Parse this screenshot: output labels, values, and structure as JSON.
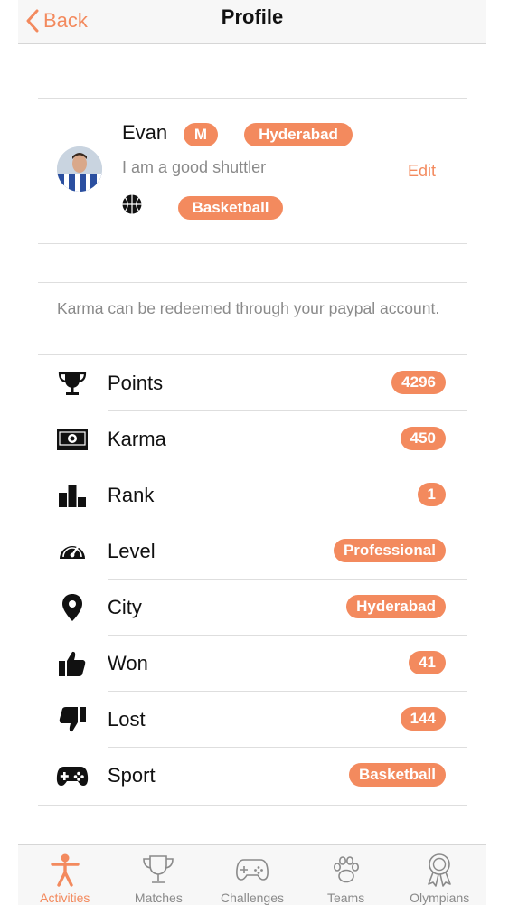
{
  "nav": {
    "back_label": "Back",
    "title": "Profile"
  },
  "profile": {
    "name": "Evan",
    "gender_badge": "M",
    "city_badge": "Hyderabad",
    "bio": "I am a good shuttler",
    "edit_label": "Edit",
    "sport_icon": "basketball-icon",
    "sport_badge": "Basketball"
  },
  "note": "Karma can be redeemed through your paypal account.",
  "stats": [
    {
      "label": "Points",
      "value": "4296",
      "icon": "trophy-icon"
    },
    {
      "label": "Karma",
      "value": "450",
      "icon": "money-icon"
    },
    {
      "label": "Rank",
      "value": "1",
      "icon": "rank-bars-icon"
    },
    {
      "label": "Level",
      "value": "Professional",
      "icon": "speedometer-icon"
    },
    {
      "label": "City",
      "value": "Hyderabad",
      "icon": "location-pin-icon"
    },
    {
      "label": "Won",
      "value": "41",
      "icon": "thumbs-up-icon"
    },
    {
      "label": "Lost",
      "value": "144",
      "icon": "thumbs-down-icon"
    },
    {
      "label": "Sport",
      "value": "Basketball",
      "icon": "gamepad-icon"
    }
  ],
  "tabs": [
    {
      "label": "Activities",
      "icon": "person-icon",
      "active": true
    },
    {
      "label": "Matches",
      "icon": "trophy-outline-icon",
      "active": false
    },
    {
      "label": "Challenges",
      "icon": "gamepad-outline-icon",
      "active": false
    },
    {
      "label": "Teams",
      "icon": "paw-icon",
      "active": false
    },
    {
      "label": "Olympians",
      "icon": "medal-icon",
      "active": false
    }
  ],
  "colors": {
    "accent": "#f38a5e",
    "muted_text": "#8a8a8a",
    "bar_bg": "#f7f7f7"
  }
}
